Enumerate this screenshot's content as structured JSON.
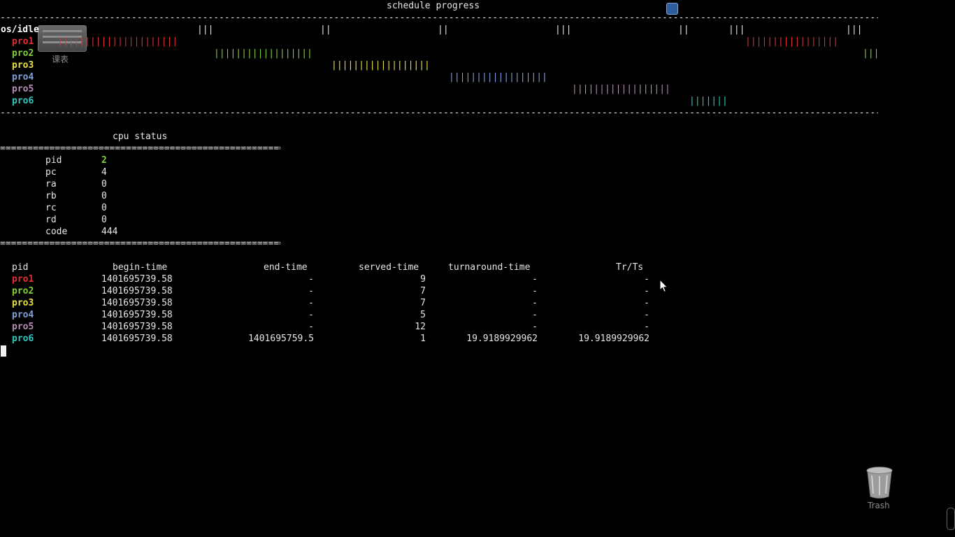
{
  "title": "schedule progress",
  "dash_line": "----------------------------------------------------------------------------------------------------------------------------------------------------------------------------------------------------------------------------------------------------",
  "eq_line": "====================================================================================================",
  "schedule": {
    "idle_label": "os/idle",
    "idle_segments": [
      "|||",
      "||",
      "||",
      "|||",
      "||",
      "|||",
      "|||"
    ],
    "processes": [
      {
        "name": "pro1",
        "color": "#e03030",
        "ticks_a": "||||||||||||||||||||||",
        "ticks_b": "|||||||||||||||||"
      },
      {
        "name": "pro2",
        "color": "#7fd03a",
        "ticks_a": "||||||||||||||||||",
        "ticks_b": "|||"
      },
      {
        "name": "pro3",
        "color": "#e8e040",
        "ticks_a": "||||||||||||||||||",
        "ticks_b": ""
      },
      {
        "name": "pro4",
        "color": "#7fa0d8",
        "ticks_a": "||||||||||||||||||",
        "ticks_b": ""
      },
      {
        "name": "pro5",
        "color": "#b48cb4",
        "ticks_a": "||||||||||||||||||",
        "ticks_b": ""
      },
      {
        "name": "pro6",
        "color": "#30c8c0",
        "ticks_a": "|||||||",
        "ticks_b": ""
      }
    ]
  },
  "cpu_status": {
    "title": "cpu status",
    "rows": [
      {
        "key": "pid",
        "value": "2",
        "color": "#7fd03a"
      },
      {
        "key": "pc",
        "value": "4",
        "color": "#e6e6e6"
      },
      {
        "key": "ra",
        "value": "0",
        "color": "#e6e6e6"
      },
      {
        "key": "rb",
        "value": "0",
        "color": "#e6e6e6"
      },
      {
        "key": "rc",
        "value": "0",
        "color": "#e6e6e6"
      },
      {
        "key": "rd",
        "value": "0",
        "color": "#e6e6e6"
      },
      {
        "key": "code",
        "value": "444",
        "color": "#e6e6e6"
      }
    ]
  },
  "table": {
    "headers": [
      "pid",
      "begin-time",
      "end-time",
      "served-time",
      "turnaround-time",
      "Tr/Ts"
    ],
    "rows": [
      {
        "pid": "pro1",
        "begin": "1401695739.58",
        "end": "-",
        "served": "9",
        "turnaround": "-",
        "trts": "-"
      },
      {
        "pid": "pro2",
        "begin": "1401695739.58",
        "end": "-",
        "served": "7",
        "turnaround": "-",
        "trts": "-"
      },
      {
        "pid": "pro3",
        "begin": "1401695739.58",
        "end": "-",
        "served": "7",
        "turnaround": "-",
        "trts": "-"
      },
      {
        "pid": "pro4",
        "begin": "1401695739.58",
        "end": "-",
        "served": "5",
        "turnaround": "-",
        "trts": "-"
      },
      {
        "pid": "pro5",
        "begin": "1401695739.58",
        "end": "-",
        "served": "12",
        "turnaround": "-",
        "trts": "-"
      },
      {
        "pid": "pro6",
        "begin": "1401695739.58",
        "end": "1401695759.5",
        "served": "1",
        "turnaround": "19.9189929962",
        "trts": "19.9189929962"
      }
    ]
  },
  "desktop": {
    "widget_label": "课表",
    "trash_label": "Trash"
  }
}
